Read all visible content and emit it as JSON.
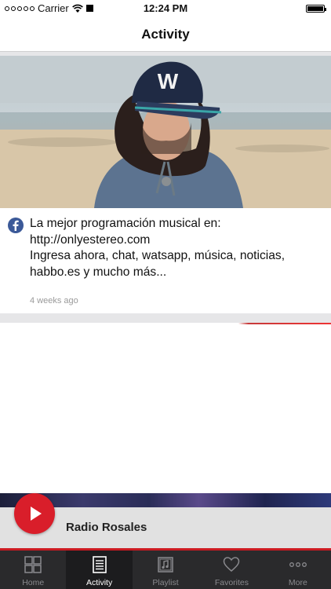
{
  "status_bar": {
    "carrier": "Carrier",
    "time": "12:24 PM"
  },
  "nav": {
    "title": "Activity"
  },
  "feed": {
    "posts": [
      {
        "source_icon": "facebook-icon",
        "text_lines": [
          "La mejor programación musical en:",
          "http://onlyestereo.com",
          "Ingresa ahora, chat,  watsapp,  música,  noticias,",
          "habbo.es y mucho más..."
        ],
        "time": "4 weeks ago"
      }
    ]
  },
  "player": {
    "station": "Radio Rosales",
    "play_icon": "play-icon",
    "accent_color": "#d91e2a"
  },
  "tab_bar": {
    "tabs": [
      {
        "label": "Home",
        "icon": "home-grid-icon",
        "active": false
      },
      {
        "label": "Activity",
        "icon": "newspaper-icon",
        "active": true
      },
      {
        "label": "Playlist",
        "icon": "music-note-icon",
        "active": false
      },
      {
        "label": "Favorites",
        "icon": "heart-icon",
        "active": false
      },
      {
        "label": "More",
        "icon": "more-dots-icon",
        "active": false
      }
    ]
  }
}
